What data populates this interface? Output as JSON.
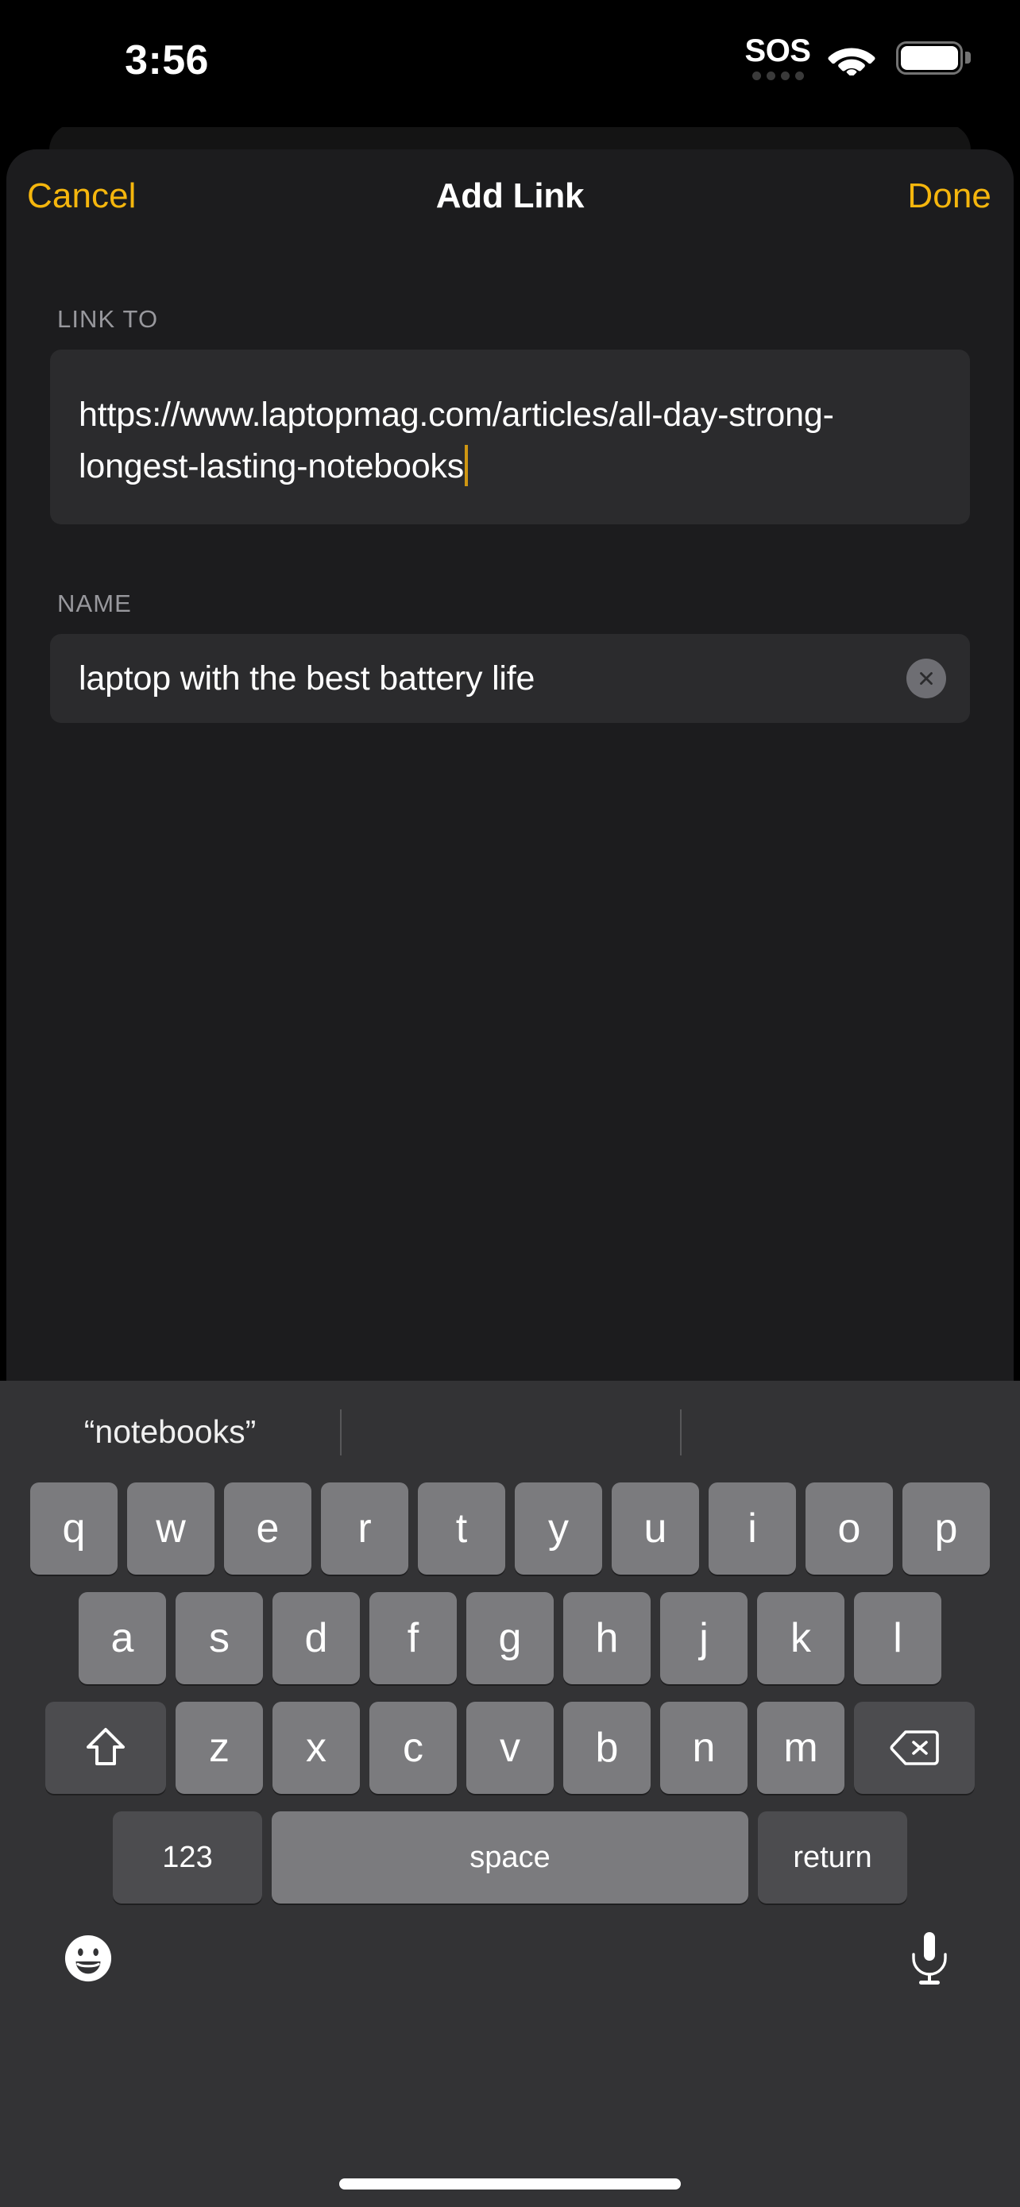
{
  "status_bar": {
    "time": "3:56",
    "sos_label": "SOS",
    "sos_dots": 4,
    "wifi_icon": "wifi-icon",
    "battery_icon": "battery-full-icon",
    "battery_level": 100
  },
  "navbar": {
    "cancel_label": "Cancel",
    "title": "Add Link",
    "done_label": "Done",
    "accent_color": "#f5b60d"
  },
  "form": {
    "link_to": {
      "label": "LINK TO",
      "value": "https://www.laptopmag.com/articles/all-day-strong-longest-lasting-notebooks",
      "placeholder": "URL",
      "focused": true,
      "caret_color": "#cf9712"
    },
    "name": {
      "label": "NAME",
      "value": "laptop with the best battery life",
      "placeholder": "Name",
      "focused": false,
      "clear_icon": "close-circle-icon"
    }
  },
  "keyboard": {
    "suggestions": [
      {
        "text": "“notebooks”"
      },
      {
        "text": ""
      },
      {
        "text": ""
      }
    ],
    "rows": [
      {
        "keys": [
          {
            "label": "q",
            "type": "letter"
          },
          {
            "label": "w",
            "type": "letter"
          },
          {
            "label": "e",
            "type": "letter"
          },
          {
            "label": "r",
            "type": "letter"
          },
          {
            "label": "t",
            "type": "letter"
          },
          {
            "label": "y",
            "type": "letter"
          },
          {
            "label": "u",
            "type": "letter"
          },
          {
            "label": "i",
            "type": "letter"
          },
          {
            "label": "o",
            "type": "letter"
          },
          {
            "label": "p",
            "type": "letter"
          }
        ]
      },
      {
        "keys": [
          {
            "label": "a",
            "type": "letter"
          },
          {
            "label": "s",
            "type": "letter"
          },
          {
            "label": "d",
            "type": "letter"
          },
          {
            "label": "f",
            "type": "letter"
          },
          {
            "label": "g",
            "type": "letter"
          },
          {
            "label": "h",
            "type": "letter"
          },
          {
            "label": "j",
            "type": "letter"
          },
          {
            "label": "k",
            "type": "letter"
          },
          {
            "label": "l",
            "type": "letter"
          }
        ]
      },
      {
        "keys": [
          {
            "label": "",
            "type": "shift",
            "icon": "shift-arrow-up-icon"
          },
          {
            "label": "z",
            "type": "letter"
          },
          {
            "label": "x",
            "type": "letter"
          },
          {
            "label": "c",
            "type": "letter"
          },
          {
            "label": "v",
            "type": "letter"
          },
          {
            "label": "b",
            "type": "letter"
          },
          {
            "label": "n",
            "type": "letter"
          },
          {
            "label": "m",
            "type": "letter"
          },
          {
            "label": "",
            "type": "delete",
            "icon": "backspace-icon"
          }
        ]
      },
      {
        "keys": [
          {
            "label": "123",
            "type": "num"
          },
          {
            "label": "space",
            "type": "space"
          },
          {
            "label": "return",
            "type": "ret"
          }
        ]
      }
    ],
    "num_label": "123",
    "space_label": "space",
    "return_label": "return",
    "emoji_icon": "emoji-smiley-icon",
    "mic_icon": "microphone-icon"
  },
  "home_indicator": "home-indicator"
}
